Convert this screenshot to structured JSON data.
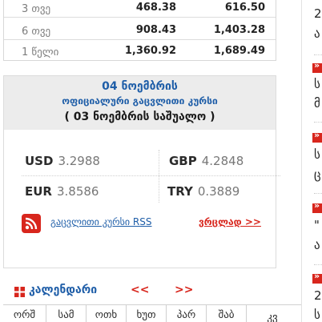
{
  "rate_table": {
    "rows": [
      {
        "period": "3 თვე",
        "value_a": "468.38",
        "value_b": "616.50"
      },
      {
        "period": "6 თვე",
        "value_a": "908.43",
        "value_b": "1,403.28"
      },
      {
        "period": "1 წელი",
        "value_a": "1,360.92",
        "value_b": "1,689.49"
      }
    ]
  },
  "official_rates": {
    "date": "04 ნოემბრის",
    "subtitle": "ოფიციალური გაცვლითი კურსი",
    "note": "( 03 ნოემბრის საშუალო )",
    "currencies": [
      {
        "code": "USD",
        "value": "3.2988"
      },
      {
        "code": "GBP",
        "value": "4.2848"
      },
      {
        "code": "EUR",
        "value": "3.8586"
      },
      {
        "code": "TRY",
        "value": "0.3889"
      }
    ],
    "rss_label": "გაცვლითი კურსი RSS",
    "more_label": "ვრცლად >>",
    "accent": "#1f5ea8",
    "link_red": "#d8261d"
  },
  "calendar": {
    "title": "კალენდარი",
    "prev_label": "<<",
    "next_label": ">>",
    "weekdays": [
      "ორშ",
      "სამ",
      "ოთხ",
      "ხუთ",
      "პარ",
      "შაბ",
      "კვ"
    ]
  },
  "news_column": {
    "items": [
      {
        "lines": [
          "2",
          "ა"
        ]
      },
      {
        "lines": [
          "ს",
          "მ"
        ]
      },
      {
        "lines": [
          "ს",
          "ც"
        ]
      },
      {
        "lines": [
          "\"",
          "ა"
        ]
      },
      {
        "lines": [
          "2",
          "ს"
        ]
      }
    ]
  }
}
